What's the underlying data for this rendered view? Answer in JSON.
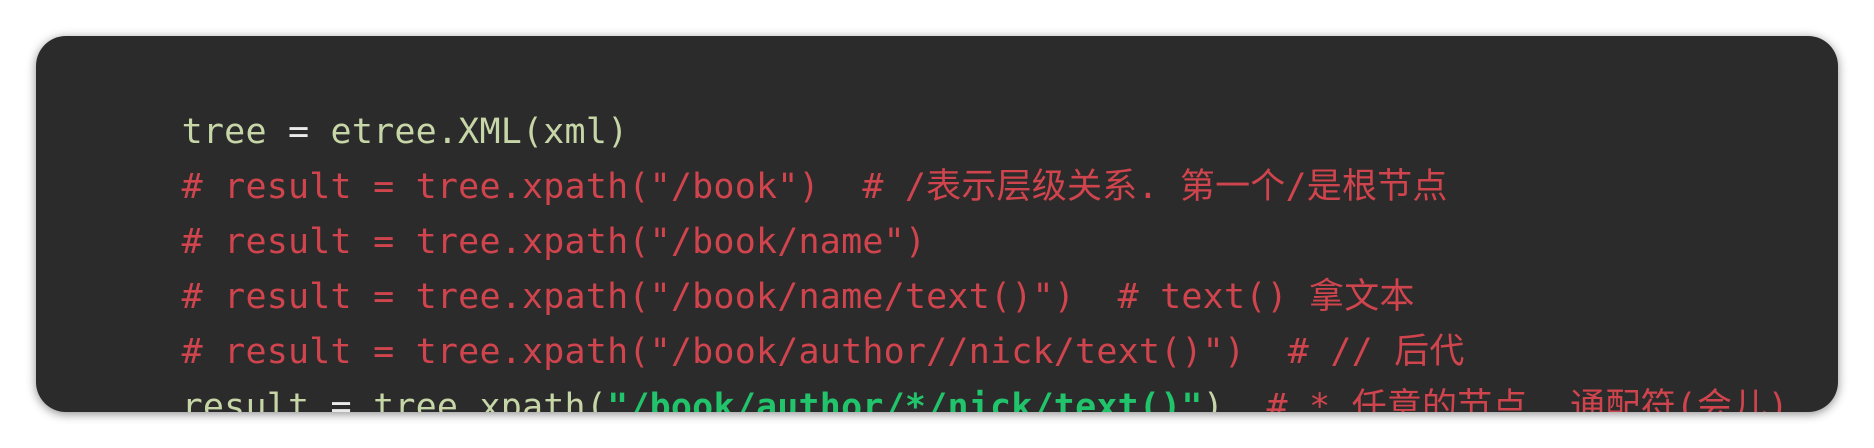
{
  "editor": {
    "lines": [
      {
        "segments": [
          {
            "text": "tree ",
            "kind": "code"
          },
          {
            "text": "=",
            "kind": "op"
          },
          {
            "text": " etree.XML(xml)",
            "kind": "code"
          }
        ]
      },
      {
        "segments": [
          {
            "text": "# result = tree.xpath(\"/book\")  # /表示层级关系. 第一个/是根节点",
            "kind": "comment"
          }
        ]
      },
      {
        "segments": [
          {
            "text": "# result = tree.xpath(\"/book/name\")",
            "kind": "comment"
          }
        ]
      },
      {
        "segments": [
          {
            "text": "# result = tree.xpath(\"/book/name/text()\")  # text() 拿文本",
            "kind": "comment"
          }
        ]
      },
      {
        "segments": [
          {
            "text": "# result = tree.xpath(\"/book/author//nick/text()\")  # // 后代",
            "kind": "comment"
          }
        ]
      },
      {
        "segments": [
          {
            "text": "result ",
            "kind": "code"
          },
          {
            "text": "=",
            "kind": "op"
          },
          {
            "text": " tree.xpath(",
            "kind": "code"
          },
          {
            "text": "\"/book/author/*/nick/text()\"",
            "kind": "str"
          },
          {
            "text": ")  ",
            "kind": "code"
          },
          {
            "text": "# * 任意的节点. 通配符(会儿)",
            "kind": "comment"
          }
        ]
      }
    ]
  },
  "colors": {
    "background": "#2b2b2b",
    "code": "#c6d6a7",
    "comment": "#d0444d",
    "string": "#21c36b"
  }
}
